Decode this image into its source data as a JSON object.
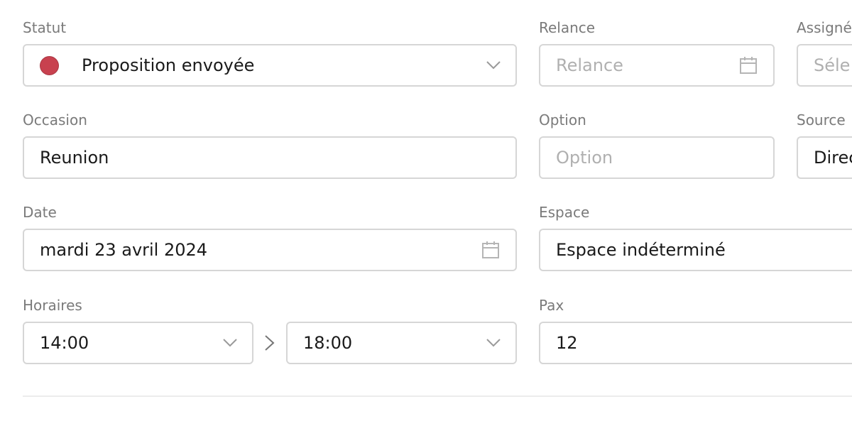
{
  "statut": {
    "label": "Statut",
    "value": "Proposition envoyée",
    "dot_color": "#c8414f"
  },
  "relance": {
    "label": "Relance",
    "placeholder": "Relance"
  },
  "assigne": {
    "label": "Assigné",
    "placeholder": "Séle"
  },
  "occasion": {
    "label": "Occasion",
    "value": "Reunion"
  },
  "option": {
    "label": "Option",
    "placeholder": "Option"
  },
  "source": {
    "label": "Source",
    "value": "Direc"
  },
  "date": {
    "label": "Date",
    "value": "mardi 23 avril 2024"
  },
  "espace": {
    "label": "Espace",
    "value": "Espace indéterminé"
  },
  "horaires": {
    "label": "Horaires",
    "start": "14:00",
    "end": "18:00",
    "separator_icon": "chevron-right-icon"
  },
  "pax": {
    "label": "Pax",
    "value": "12"
  },
  "icons": {
    "dropdown": "chevron-down-icon",
    "calendar": "calendar-icon"
  },
  "colors": {
    "border": "#d6d6d6",
    "label": "#7a7a7a",
    "text": "#1a1a1a",
    "placeholder": "#b0b0b0"
  }
}
